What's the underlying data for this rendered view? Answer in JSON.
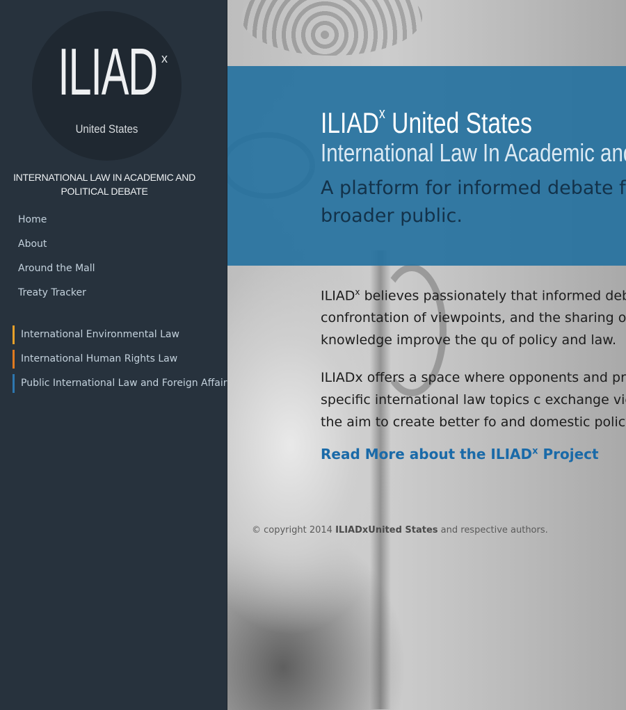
{
  "sidebar": {
    "logo": {
      "wordmark": "ILIAD",
      "superscript": "x",
      "subtitle": "United States"
    },
    "tagline": "INTERNATIONAL LAW IN ACADEMIC AND POLITICAL DEBATE",
    "nav": [
      {
        "label": "Home"
      },
      {
        "label": "About"
      },
      {
        "label": "Around the Mall"
      },
      {
        "label": "Treaty Tracker"
      }
    ],
    "subjects": [
      {
        "label": "International Environmental Law",
        "color": "#e7a02a"
      },
      {
        "label": "International Human Rights Law",
        "color": "#e07a1f"
      },
      {
        "label": "Public International Law and Foreign Affairs",
        "color": "#2d77b0"
      }
    ]
  },
  "banner": {
    "title_main": "ILIAD",
    "title_sup": "x",
    "title_rest": " United States",
    "subtitle": "International Law In Academic and",
    "description": "A platform for informed debate fo broader public.",
    "color": "#22709e"
  },
  "content": {
    "para1_a": "ILIAD",
    "para1_sup": "x",
    "para1_b": " believes passionately that informed deba respectful confrontation of viewpoints, and the sharing of ideas and knowledge improve the qu of policy and law.",
    "para2": "ILIADx offers a space where opponents and proponents of specific international law topics c exchange views, with the aim to create better fo and domestic policy.",
    "read_more_a": "Read More about the ILIAD",
    "read_more_sup": "x",
    "read_more_b": " Project"
  },
  "footer": {
    "prefix": "© copyright 2014 ",
    "name": "ILIADxUnited States",
    "suffix": " and respective authors."
  }
}
